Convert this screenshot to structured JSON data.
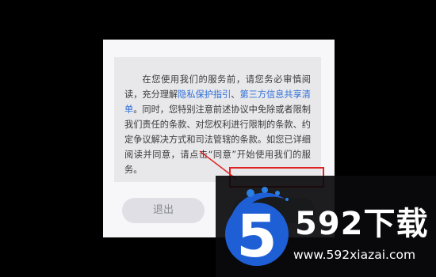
{
  "dialog": {
    "text_before_links": "在您使用我们的服务前，请您务必审慎阅读，充分理解",
    "link_privacy": "隐私保护指引",
    "separator": "、",
    "link_third_party": "第三方信息共享清单",
    "text_after_links": "。同时，您特别注意前述协议中免除或者限制我们责任的条款、对您权利进行限制的条款、约定争议解决方式和司法管辖的条款。如您已详细阅读并同意，请点击“同意”开始使用我们的服务。",
    "exit_label": "退出"
  },
  "watermark": {
    "brand": "592下载",
    "logo_digit": "5",
    "url": "www.592xiazai.com"
  },
  "colors": {
    "link": "#2f6fd8",
    "highlight": "#e02424",
    "logo_blue": "#1f5fd6"
  }
}
